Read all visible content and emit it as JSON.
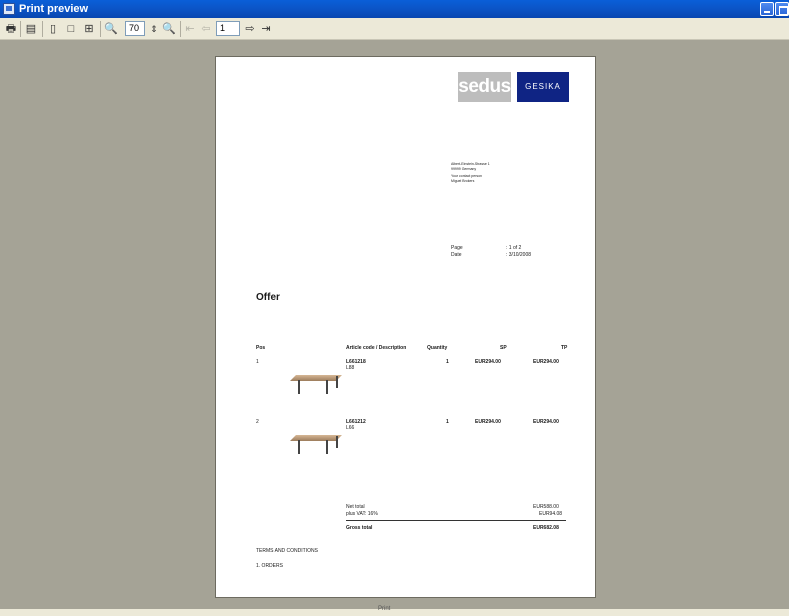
{
  "window": {
    "title": "Print preview"
  },
  "toolbar": {
    "zoom_value": "70",
    "page_value": "1"
  },
  "doc": {
    "logo_sedus": "sedus",
    "logo_gesika": "GESIKA",
    "address": [
      "Albert-Einstein-Strasse 1",
      "99999 Germany"
    ],
    "contact": [
      "Your contact person",
      "Miguel Brokers"
    ],
    "page_label": "Page",
    "page_value": ": 1 of 2",
    "date_label": "Date",
    "date_value": ": 3/10/2008",
    "title": "Offer",
    "headers": {
      "pos": "Pos",
      "article": "Article code / Description",
      "qty": "Quantity",
      "sp": "SP",
      "tp": "TP"
    },
    "items": [
      {
        "pos": "1",
        "code": "L661218",
        "desc": "L88",
        "qty": "1",
        "sp": "EUR294.00",
        "tp": "EUR294.00"
      },
      {
        "pos": "2",
        "code": "L661212",
        "desc": "L66",
        "qty": "1",
        "sp": "EUR294.00",
        "tp": "EUR294.00"
      }
    ],
    "net_total_label": "Net total",
    "net_total_value": "EUR588.00",
    "vat_label": "plus VAT: 16%",
    "vat_value": "EUR94.08",
    "gross_total_label": "Gross total",
    "gross_total_value": "EUR682.08",
    "terms_heading": "TERMS AND CONDITIONS",
    "terms_item": "1. ORDERS"
  },
  "status": {
    "text": "Print"
  }
}
